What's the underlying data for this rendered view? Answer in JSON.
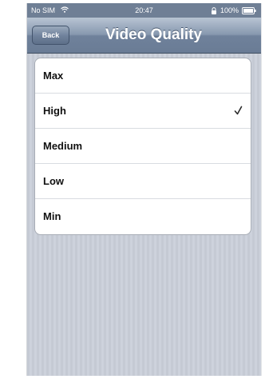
{
  "status_bar": {
    "carrier": "No SIM",
    "time": "20:47",
    "battery": "100%",
    "icons": [
      "wifi-icon",
      "lock-icon",
      "battery-icon"
    ]
  },
  "nav": {
    "back_label": "Back",
    "title": "Video Quality"
  },
  "options": [
    {
      "label": "Max",
      "selected": false
    },
    {
      "label": "High",
      "selected": true
    },
    {
      "label": "Medium",
      "selected": false
    },
    {
      "label": "Low",
      "selected": false
    },
    {
      "label": "Min",
      "selected": false
    }
  ],
  "colors": {
    "nav_bar": "#6f819b",
    "background": "#c7ccd6",
    "check": "#2b2b2b"
  }
}
